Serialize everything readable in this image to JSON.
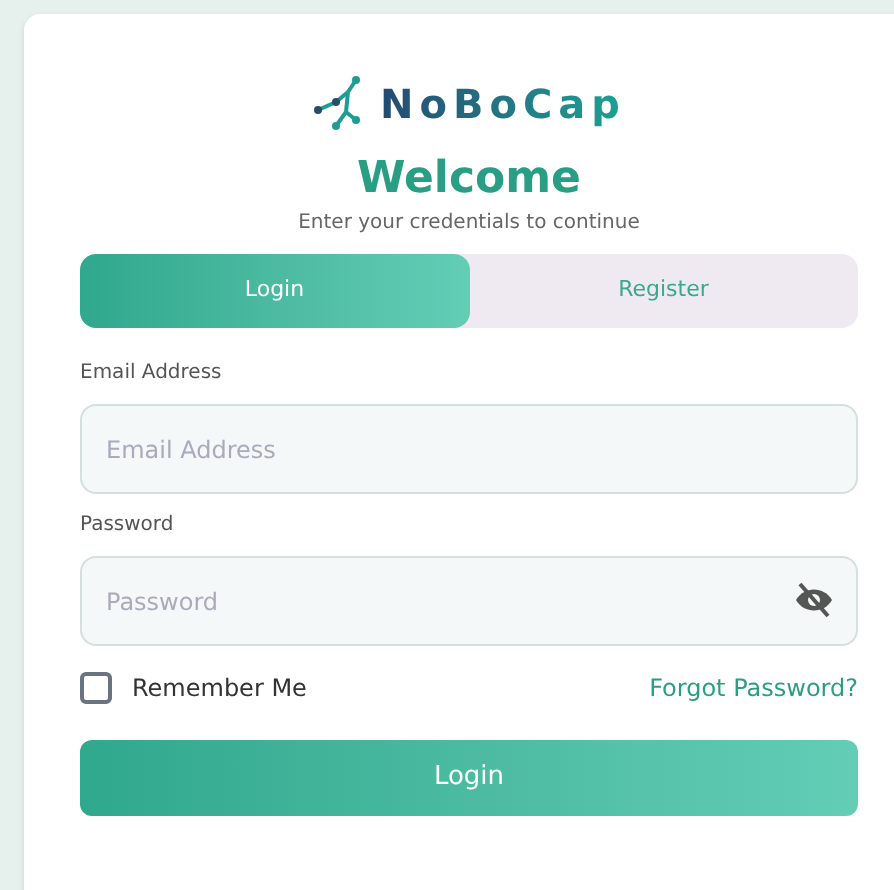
{
  "logo": {
    "text": "NoBoCap"
  },
  "heading": "Welcome",
  "subtitle": "Enter your credentials to continue",
  "tabs": [
    {
      "label": "Login",
      "selected": true
    },
    {
      "label": "Register",
      "selected": false
    }
  ],
  "email": {
    "label": "Email Address",
    "placeholder": "Email Address"
  },
  "password": {
    "label": "Password",
    "placeholder": "Password"
  },
  "remember": {
    "label": "Remember Me",
    "checked": false
  },
  "forgot_link": "Forgot Password?",
  "submit": "Login"
}
